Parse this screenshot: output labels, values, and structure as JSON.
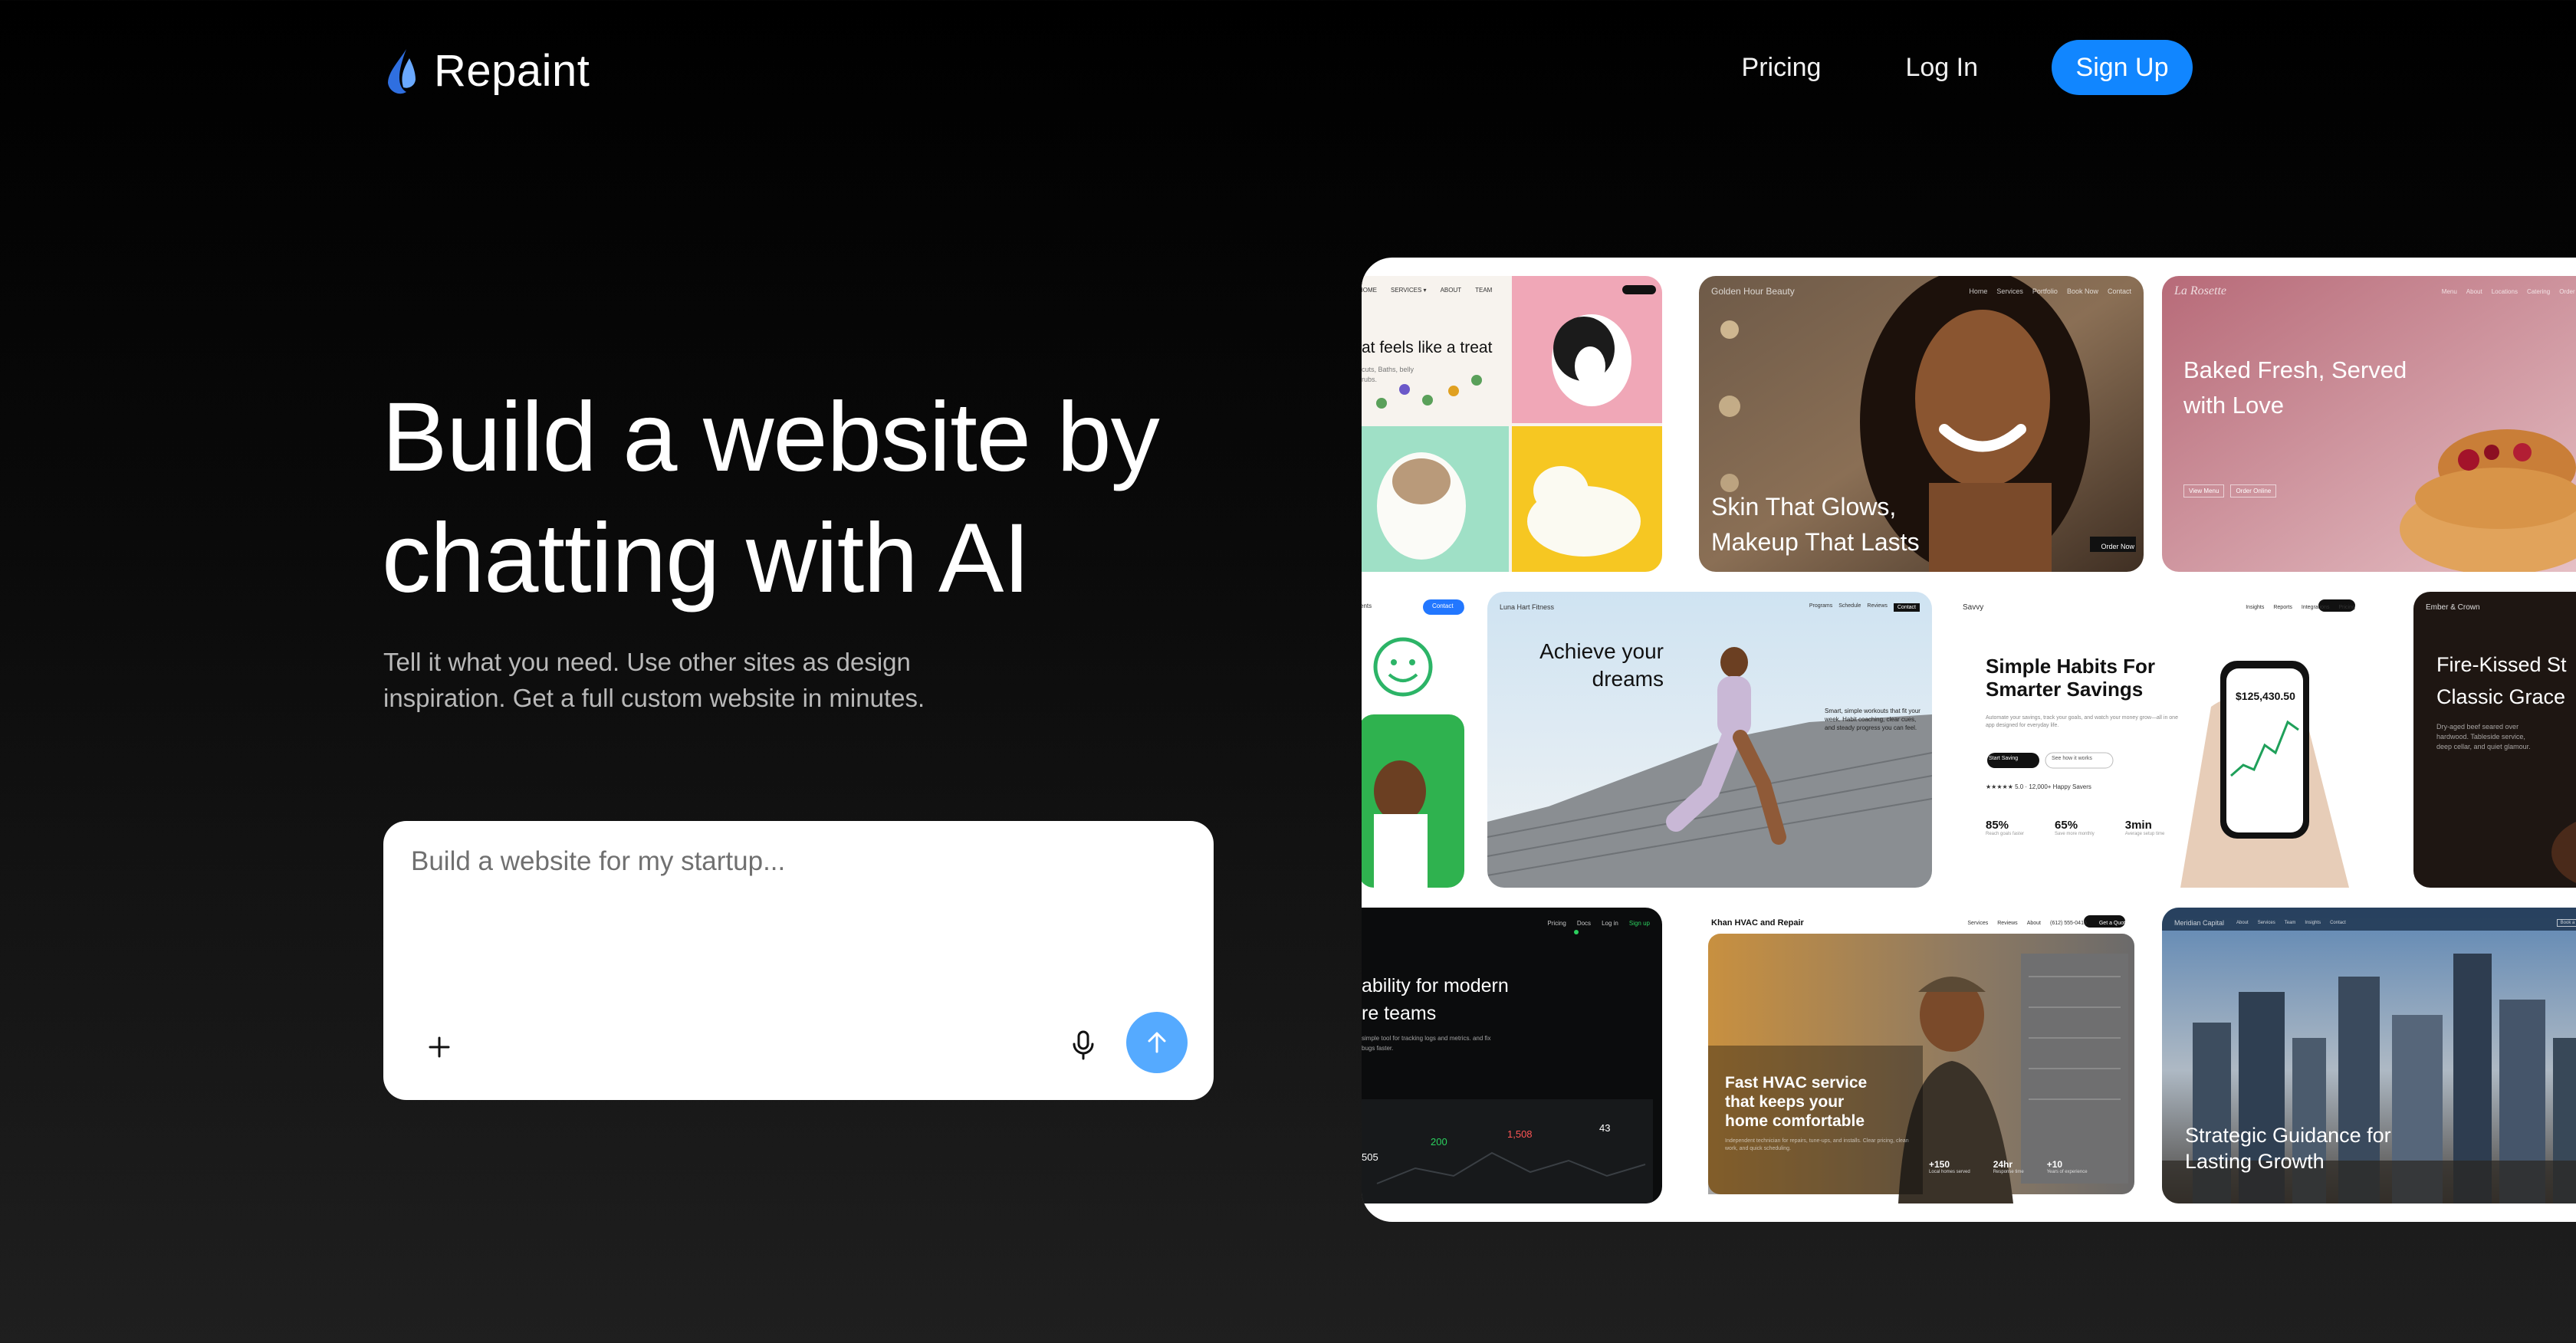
{
  "header": {
    "brand": "Repaint",
    "nav": [
      "Pricing",
      "Log In"
    ],
    "signup_label": "Sign Up"
  },
  "hero": {
    "headline": "Build a website by chatting with AI",
    "subtext": "Tell it what you need. Use other sites as design inspiration. Get a full custom website in minutes.",
    "prompt_placeholder": "Build a website for my startup..."
  },
  "colors": {
    "accent": "#1186ff",
    "send_button": "#55aaff",
    "background": "#000000"
  },
  "icons": {
    "logo": "droplet-logo-icon",
    "attach": "plus-icon",
    "voice": "microphone-icon",
    "send": "arrow-up-icon"
  },
  "showcase": {
    "pet_card": {
      "headline": "at feels like a treat",
      "sub": "cuts, Baths, belly rubs."
    },
    "beauty_card": {
      "brand": "Golden Hour Beauty",
      "nav": [
        "Home",
        "Services",
        "Portfolio",
        "Book Now",
        "Contact"
      ],
      "headline": [
        "Skin That Glows,",
        "Makeup That Lasts"
      ],
      "cta": "Order Now"
    },
    "bakery_card": {
      "brand": "La Rosette",
      "nav": [
        "Menu",
        "About",
        "Locations",
        "Catering",
        "Order Online"
      ],
      "headline": [
        "Baked Fresh, Served",
        "with Love"
      ],
      "buttons": [
        "View Menu",
        "Order Online"
      ]
    },
    "kids_card": {
      "nav": [
        "ents",
        "Contact"
      ]
    },
    "fitness_card": {
      "brand": "Luna Hart Fitness",
      "nav": [
        "Programs",
        "Schedule",
        "Reviews",
        "Contact"
      ],
      "headline": [
        "Achieve your",
        "dreams"
      ],
      "sub": "Smart, simple workouts that fit your week. Habit coaching, clear cues, and steady progress you can feel."
    },
    "finance_card": {
      "brand": "Savvy",
      "nav": [
        "Insights",
        "Reports",
        "Integrations",
        "Pricing",
        "Contact"
      ],
      "headline": [
        "Simple Habits For",
        "Smarter Savings"
      ],
      "sub": "Automate your savings, track your goals, and watch your money grow—all in one app designed for everyday life.",
      "buttons": [
        "Start Saving",
        "See how it works"
      ],
      "rating": "★★★★★  5.0 · 12,000+ Happy Savers",
      "balance": "$125,430.50",
      "stats": [
        {
          "value": "85%",
          "label": "Reach goals faster"
        },
        {
          "value": "65%",
          "label": "Save more monthly"
        },
        {
          "value": "3min",
          "label": "Average setup time"
        }
      ]
    },
    "restaurant_card": {
      "brand": "Ember & Crown",
      "headline": [
        "Fire-Kissed St",
        "Classic Grace"
      ],
      "sub": "Dry-aged beef seared over hardwood. Tableside service, deep cellar, and quiet glamour."
    },
    "saas_card": {
      "nav": [
        "Pricing",
        "Docs",
        "Log in",
        "Sign up"
      ],
      "headline": [
        "ability for modern",
        "re teams"
      ],
      "sub": "simple tool for tracking logs and metrics. and fix bugs faster.",
      "metrics": [
        "505",
        "200",
        "1,508",
        "43"
      ]
    },
    "hvac_card": {
      "brand": "Khan HVAC and Repair",
      "nav": [
        "Services",
        "Reviews",
        "About",
        "(612) 555-0415",
        "Get a Quote"
      ],
      "headline": [
        "Fast HVAC service",
        "that keeps your",
        "home comfortable"
      ],
      "sub": "Independent technician for repairs, tune-ups, and installs. Clear pricing, clean work, and quick scheduling.",
      "stats": [
        {
          "value": "+150",
          "label": "Local homes served"
        },
        {
          "value": "24hr",
          "label": "Response time"
        },
        {
          "value": "+10",
          "label": "Years of experience"
        }
      ]
    },
    "consulting_card": {
      "brand": "Meridian Capital",
      "nav": [
        "About",
        "Services",
        "Team",
        "Insights",
        "Contact",
        "Book a consult"
      ],
      "headline": [
        "Strategic Guidance for",
        "Lasting Growth"
      ]
    }
  }
}
